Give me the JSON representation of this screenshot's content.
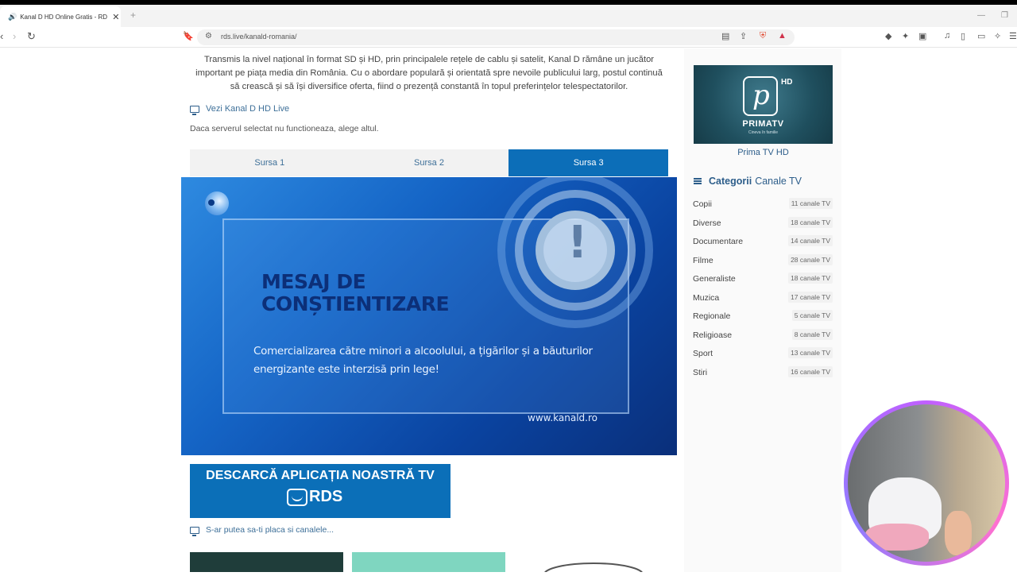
{
  "browser": {
    "tab_title": "Kanal D HD Online Gratis - RDS",
    "tab_close": "✕",
    "new_tab": "+",
    "url": "rds.live/kanald-romania/"
  },
  "main": {
    "intro": "Transmis la nivel național în format SD și HD, prin principalele rețele de cablu și satelit, Kanal D rămâne un jucător important pe piața media din România. Cu o abordare populară și orientată spre nevoile publicului larg, postul continuă să crească și să își diversifice oferta, fiind o prezență constantă în topul preferințelor telespectatorilor.",
    "live_link": "Vezi Kanal D HD Live",
    "server_note": "Daca serverul selectat nu functioneaza, alege altul.",
    "source_tabs": [
      "Sursa 1",
      "Sursa 2",
      "Sursa 3"
    ],
    "active_source": "Sursa 3",
    "player": {
      "title_line1": "MESAJ DE",
      "title_line2": "CONȘTIENTIZARE",
      "body": "Comercializarea către minori a alcoolului, a țigărilor și a băuturilor energizante este interzisă prin lege!",
      "site": "www.kanald.ro"
    },
    "app_banner": {
      "title": "DESCARCĂ APLICAȚIA NOASTRĂ TV",
      "logo": "RDS"
    },
    "suggest_link": "S-ar putea sa-ti placa si canalele..."
  },
  "sidebar": {
    "featured": {
      "hd": "HD",
      "logo_name": "PRIMATV",
      "logo_tagline": "Cineva în familie",
      "caption": "Prima TV HD"
    },
    "categories_title_bold": "Categorii",
    "categories_title_rest": "Canale TV",
    "categories": [
      {
        "name": "Copii",
        "count": "11 canale TV"
      },
      {
        "name": "Diverse",
        "count": "18 canale TV"
      },
      {
        "name": "Documentare",
        "count": "14 canale TV"
      },
      {
        "name": "Filme",
        "count": "28 canale TV"
      },
      {
        "name": "Generaliste",
        "count": "18 canale TV"
      },
      {
        "name": "Muzica",
        "count": "17 canale TV"
      },
      {
        "name": "Regionale",
        "count": "5 canale TV"
      },
      {
        "name": "Religioase",
        "count": "8 canale TV"
      },
      {
        "name": "Sport",
        "count": "13 canale TV"
      },
      {
        "name": "Stiri",
        "count": "16 canale TV"
      }
    ]
  },
  "colors": {
    "accent": "#0c6eb8",
    "link": "#3d6f98",
    "player_bg": "#1565c6"
  }
}
